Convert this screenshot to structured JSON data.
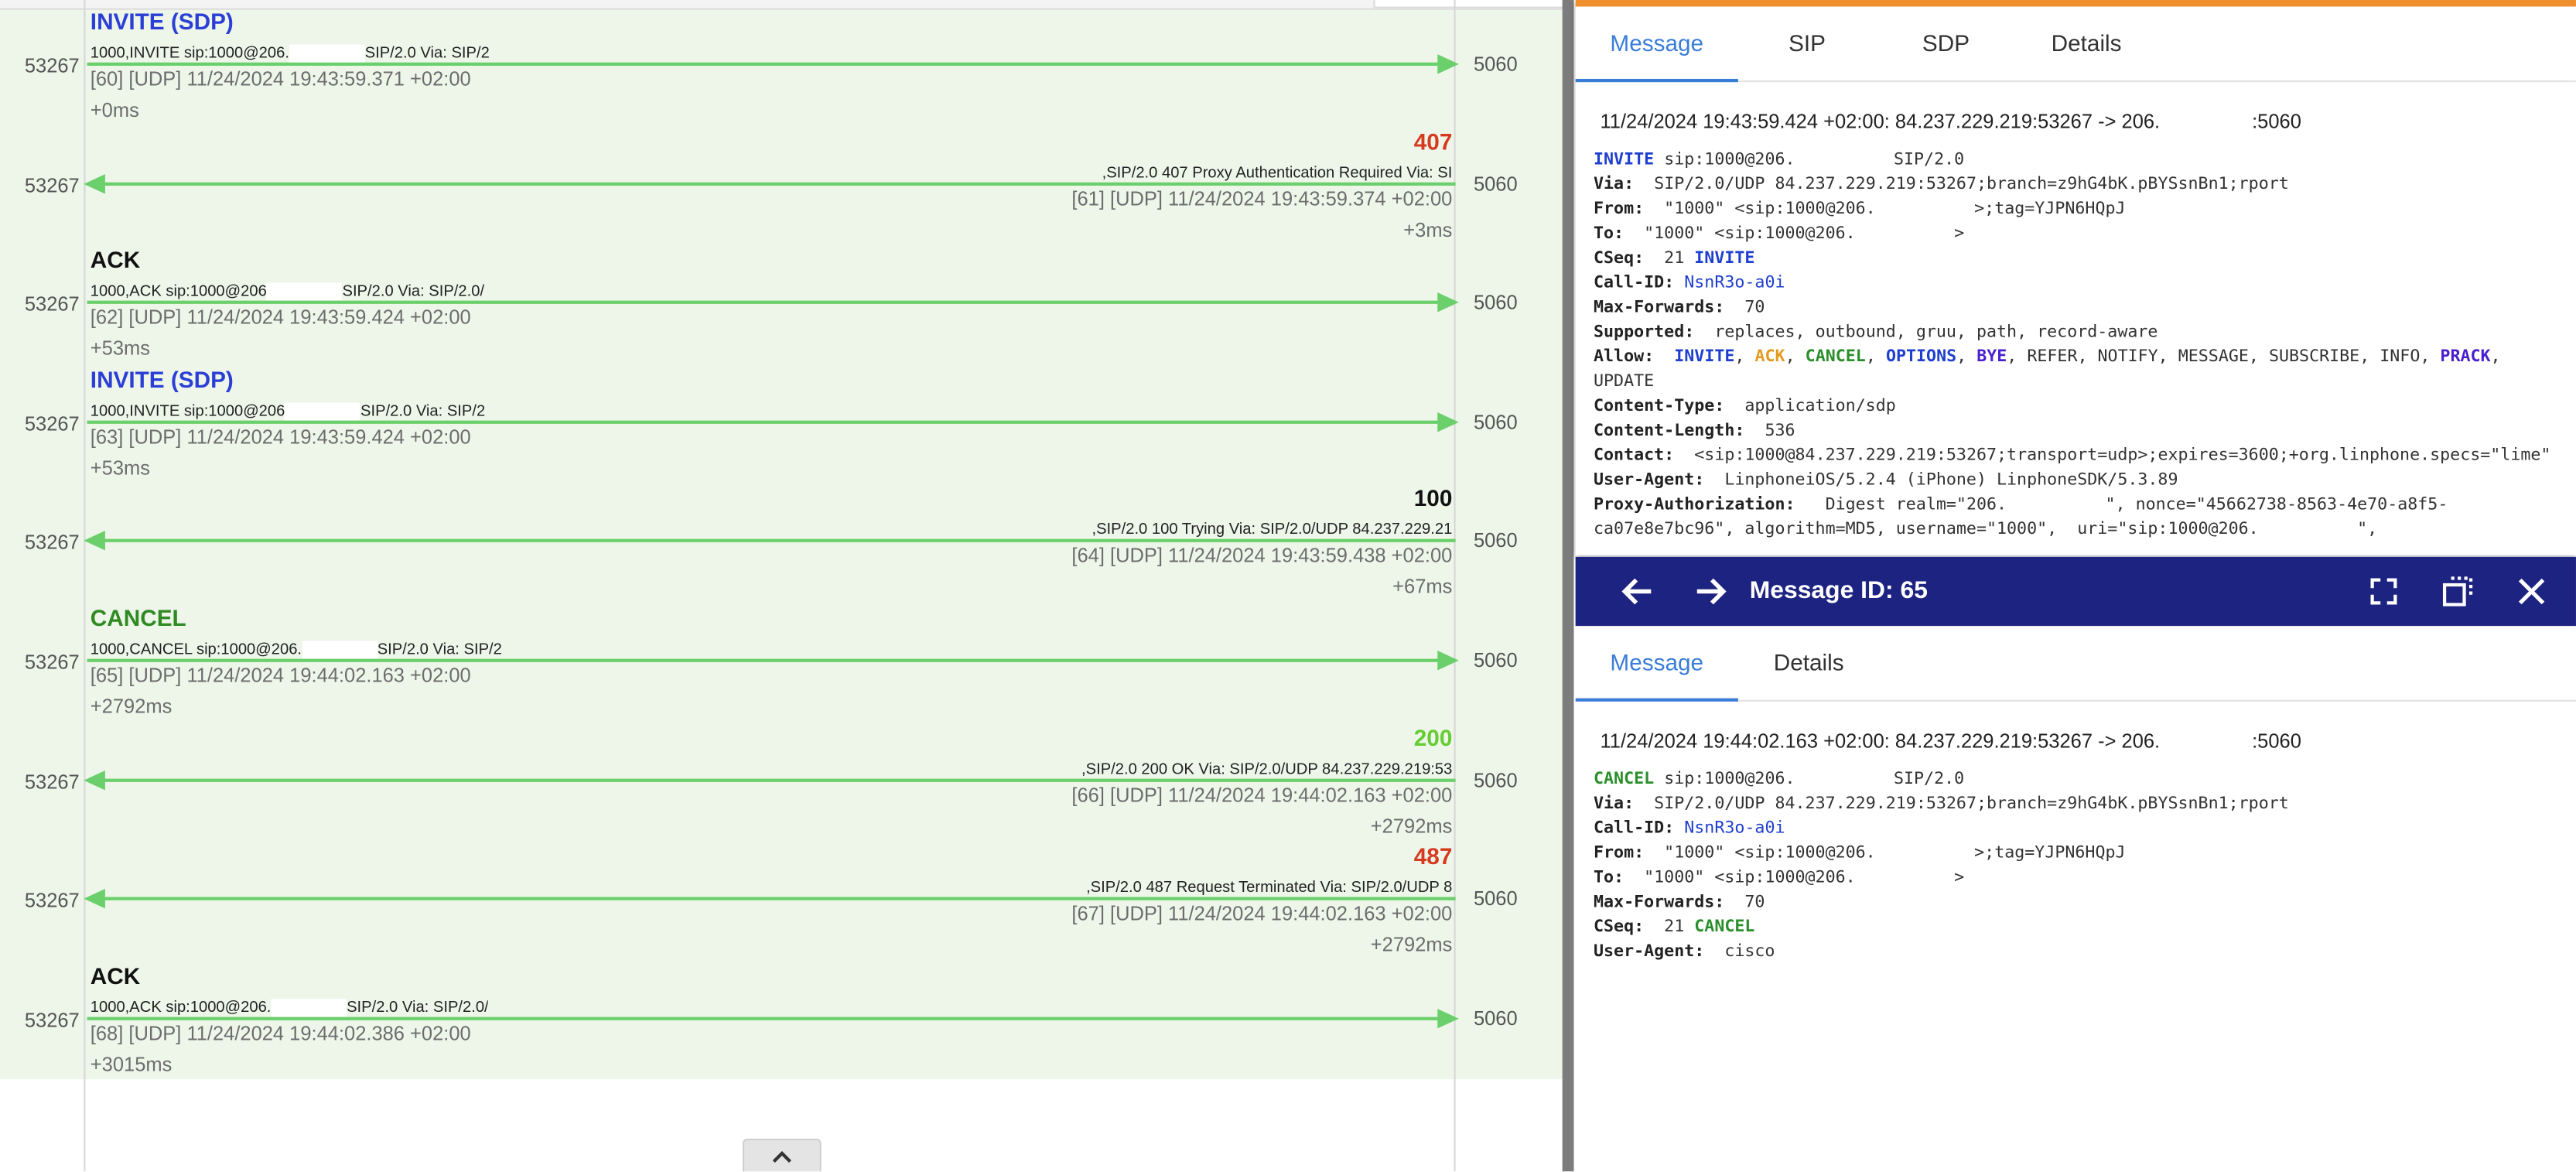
{
  "flow": {
    "rows": [
      {
        "dir": "right",
        "label": "INVITE (SDP)",
        "label_color": "#2b3fd6",
        "summary_a": "1000,INVITE sip:1000@206.",
        "summary_b": "SIP/2.0 Via: SIP/2",
        "meta": "[60] [UDP] 11/24/2024 19:43:59.371 +02:00",
        "delta": "+0ms",
        "src_port": "53267",
        "dst_port": "5060"
      },
      {
        "dir": "left",
        "label": "407",
        "label_color": "#d63b1f",
        "summary_a": ",SIP/2.0 407 Proxy Authentication Required Via: SI",
        "summary_b": "",
        "meta": "[61] [UDP] 11/24/2024 19:43:59.374 +02:00",
        "delta": "+3ms",
        "src_port": "53267",
        "dst_port": "5060"
      },
      {
        "dir": "right",
        "label": "ACK",
        "label_color": "#111111",
        "summary_a": "1000,ACK sip:1000@206",
        "summary_b": "SIP/2.0 Via: SIP/2.0/",
        "meta": "[62] [UDP] 11/24/2024 19:43:59.424 +02:00",
        "delta": "+53ms",
        "src_port": "53267",
        "dst_port": "5060"
      },
      {
        "dir": "right",
        "label": "INVITE (SDP)",
        "label_color": "#2b3fd6",
        "summary_a": "1000,INVITE sip:1000@206",
        "summary_b": "SIP/2.0 Via: SIP/2",
        "meta": "[63] [UDP] 11/24/2024 19:43:59.424 +02:00",
        "delta": "+53ms",
        "src_port": "53267",
        "dst_port": "5060"
      },
      {
        "dir": "left",
        "label": "100",
        "label_color": "#111111",
        "summary_a": ",SIP/2.0 100 Trying Via: SIP/2.0/UDP 84.237.229.21",
        "summary_b": "",
        "meta": "[64] [UDP] 11/24/2024 19:43:59.438 +02:00",
        "delta": "+67ms",
        "src_port": "53267",
        "dst_port": "5060"
      },
      {
        "dir": "right",
        "label": "CANCEL",
        "label_color": "#2f8a22",
        "summary_a": "1000,CANCEL sip:1000@206.",
        "summary_b": "SIP/2.0 Via: SIP/2",
        "meta": "[65] [UDP] 11/24/2024 19:44:02.163 +02:00",
        "delta": "+2792ms",
        "src_port": "53267",
        "dst_port": "5060"
      },
      {
        "dir": "left",
        "label": "200",
        "label_color": "#66cc33",
        "summary_a": ",SIP/2.0 200 OK Via: SIP/2.0/UDP 84.237.229.219:53",
        "summary_b": "",
        "meta": "[66] [UDP] 11/24/2024 19:44:02.163 +02:00",
        "delta": "+2792ms",
        "src_port": "53267",
        "dst_port": "5060"
      },
      {
        "dir": "left",
        "label": "487",
        "label_color": "#d63b1f",
        "summary_a": ",SIP/2.0 487 Request Terminated Via: SIP/2.0/UDP 8",
        "summary_b": "",
        "meta": "[67] [UDP] 11/24/2024 19:44:02.163 +02:00",
        "delta": "+2792ms",
        "src_port": "53267",
        "dst_port": "5060"
      },
      {
        "dir": "right",
        "label": "ACK",
        "label_color": "#111111",
        "summary_a": "1000,ACK sip:1000@206.",
        "summary_b": "SIP/2.0 Via: SIP/2.0/",
        "meta": "[68] [UDP] 11/24/2024 19:44:02.386 +02:00",
        "delta": "+3015ms",
        "src_port": "53267",
        "dst_port": "5060"
      }
    ],
    "arrow_color": "#6bd06b"
  },
  "panel1": {
    "tabs": [
      "Message",
      "SIP",
      "SDP",
      "Details"
    ],
    "header_a": "11/24/2024 19:43:59.424 +02:00: 84.237.229.219:53267 -> 206.",
    "header_b": ":5060",
    "lines": {
      "l1_method": "INVITE",
      "l1_uri": " sip:1000@206.",
      "l1_ver": "SIP/2.0",
      "via_k": "Via:",
      "via_v": "  SIP/2.0/UDP 84.237.229.219:53267;branch=z9hG4bK.pBYSsnBn1;rport",
      "from_k": "From:",
      "from_v": "  \"1000\" <sip:1000@206.",
      "from_t": ">;tag=YJPN6HQpJ",
      "to_k": "To:",
      "to_v": "  \"1000\" <sip:1000@206.",
      "to_t": ">",
      "cseq_k": "CSeq:",
      "cseq_n": "  21 ",
      "cseq_m": "INVITE",
      "callid_k": "Call-ID:",
      "callid_v": "NsnR3o-a0i",
      "maxf_k": "Max-Forwards:",
      "maxf_v": "  70",
      "supp_k": "Supported:",
      "supp_v": "  replaces, outbound, gruu, path, record-aware",
      "allow_k": "Allow:",
      "allow_invite": "INVITE",
      "allow_ack": "ACK",
      "allow_cancel": "CANCEL",
      "allow_options": "OPTIONS",
      "allow_bye": "BYE",
      "allow_rest": ", REFER, NOTIFY, MESSAGE, SUBSCRIBE, INFO, ",
      "allow_prack": "PRACK",
      "allow_update": "UPDATE",
      "ctype_k": "Content-Type:",
      "ctype_v": "  application/sdp",
      "clen_k": "Content-Length:",
      "clen_v": "  536",
      "contact_k": "Contact:",
      "contact_v": "  <sip:1000@84.237.229.219:53267;transport=udp>;expires=3600;+org.linphone.specs=\"lime\"",
      "ua_k": "User-Agent:",
      "ua_v": "  LinphoneiOS/5.2.4 (iPhone) LinphoneSDK/5.3.89",
      "pa_k": "Proxy-Authorization:",
      "pa_v": "   Digest realm=\"206.",
      "pa_v2": "\", nonce=\"45662738-8563-4e70-a8f5-",
      "pa_l2": "ca07e8e7bc96\", algorithm=MD5, username=\"1000\",  uri=\"sip:1000@206.",
      "pa_l2b": "\","
    }
  },
  "panel2": {
    "title": "Message ID: 65",
    "tabs": [
      "Message",
      "Details"
    ],
    "header_a": "11/24/2024 19:44:02.163 +02:00: 84.237.229.219:53267 -> 206.",
    "header_b": ":5060",
    "lines": {
      "l1_method": "CANCEL",
      "l1_uri": " sip:1000@206.",
      "l1_ver": "SIP/2.0",
      "via_k": "Via:",
      "via_v": "  SIP/2.0/UDP 84.237.229.219:53267;branch=z9hG4bK.pBYSsnBn1;rport",
      "callid_k": "Call-ID:",
      "callid_v": "NsnR3o-a0i",
      "from_k": "From:",
      "from_v": "  \"1000\" <sip:1000@206.",
      "from_t": ">;tag=YJPN6HQpJ",
      "to_k": "To:",
      "to_v": "  \"1000\" <sip:1000@206.",
      "to_t": ">",
      "maxf_k": "Max-Forwards:",
      "maxf_v": "  70",
      "cseq_k": "CSeq:",
      "cseq_n": "  21 ",
      "cseq_m": "CANCEL",
      "ua_k": "User-Agent:",
      "ua_v": "  cisco"
    }
  },
  "icons": {
    "back": "arrow-left-icon",
    "forward": "arrow-right-icon",
    "fullscreen": "fullscreen-icon",
    "popout": "popout-icon",
    "close": "close-icon",
    "collapse": "chevron-up-icon"
  }
}
